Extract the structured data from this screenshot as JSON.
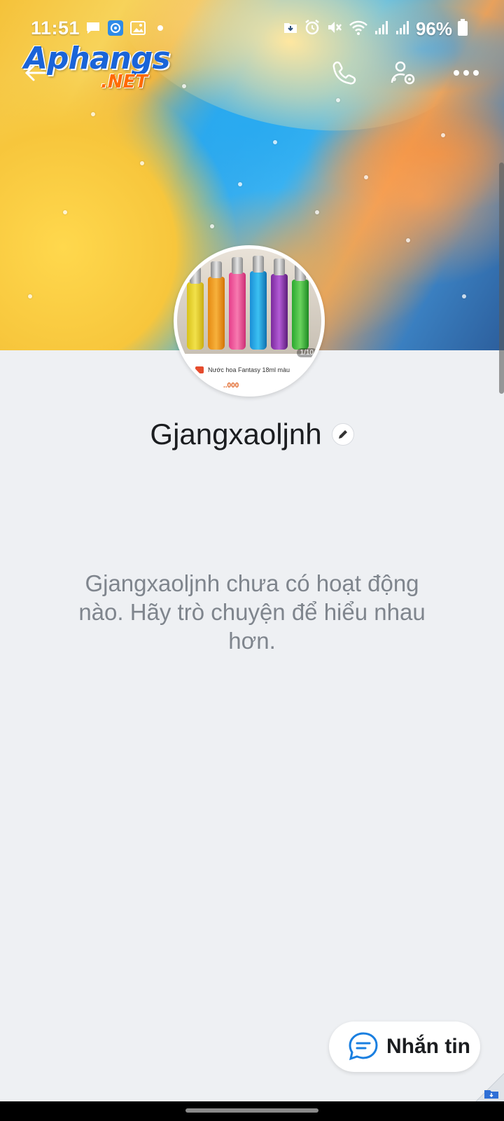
{
  "status_bar": {
    "time": "11:51",
    "battery_percent": "96%",
    "left_icons": [
      "chat-bubble-icon",
      "browser-app-icon",
      "gallery-icon",
      "dot-icon"
    ],
    "right_icons": [
      "download-icon",
      "alarm-icon",
      "mute-icon",
      "wifi-icon",
      "signal-icon",
      "signal-icon",
      "battery-icon"
    ]
  },
  "watermark": {
    "main": "Aphangs",
    "sub": ".NET"
  },
  "header": {
    "back_icon": "back-arrow-icon",
    "actions": [
      "phone-icon",
      "user-settings-icon",
      "more-icon"
    ]
  },
  "avatar": {
    "counter": "1/10",
    "caption": "Nước hoa Fantasy 18ml màu",
    "price": "..000"
  },
  "profile": {
    "name": "Gjangxaoljnh",
    "empty_message": "Gjangxaoljnh chưa có hoạt động nào. Hãy trò chuyện để hiểu nhau hơn."
  },
  "message_button": {
    "label": "Nhắn tin",
    "icon": "chat-icon"
  },
  "colors": {
    "page_bg": "#eef0f3",
    "accent": "#1a7fe0",
    "text_muted": "#7f858d"
  }
}
